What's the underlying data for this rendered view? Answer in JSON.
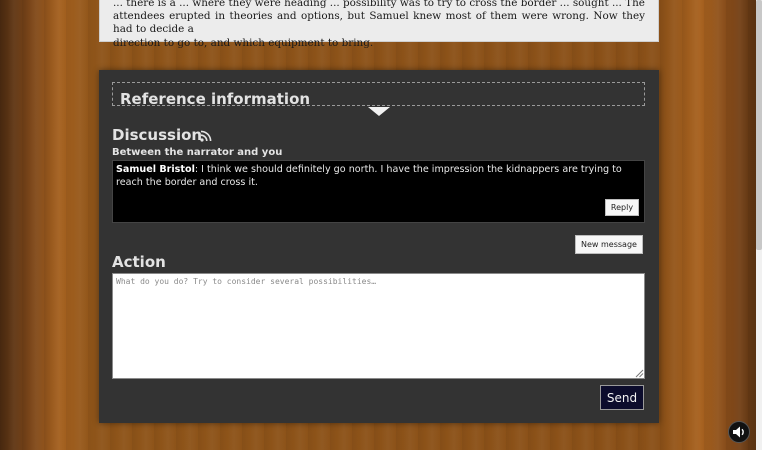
{
  "story": {
    "lines": [
      "... there is a ... where they were heading ... possibility was to try to cross the border ... sought ... The",
      "attendees erupted in theories and options, but Samuel knew most of them were wrong. Now they had to decide a",
      "direction to go to, and which equipment to bring."
    ]
  },
  "reference": {
    "title": "Reference information"
  },
  "discussion": {
    "title": "Discussion",
    "subtitle": "Between the narrator and you",
    "messages": [
      {
        "author": "Samuel Bristol",
        "text": ": I think we should definitely go north. I have the impression the kidnappers are trying to reach the border and cross it.",
        "reply_label": "Reply"
      }
    ],
    "new_message_label": "New message"
  },
  "action": {
    "title": "Action",
    "placeholder": "What do you do? Try to consider several possibilities…",
    "value": "",
    "send_label": "Send"
  },
  "icons": {
    "feed": "rss-icon",
    "sound": "speaker-icon",
    "toggle": "triangle-down-icon"
  },
  "colors": {
    "panel": "#333333",
    "send_button": "#0c0c2c",
    "message_box": "#000000"
  }
}
